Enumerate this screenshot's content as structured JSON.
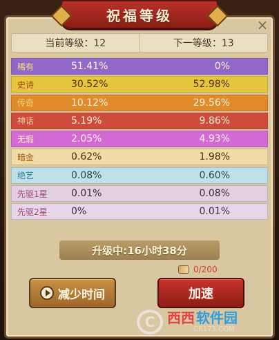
{
  "title": "祝福等级",
  "close_label": "×",
  "header": {
    "current": "当前等级：12",
    "next": "下一等级：13"
  },
  "rows": [
    {
      "name": "稀有",
      "current": "51.41%",
      "next": "0%"
    },
    {
      "name": "史诗",
      "current": "30.52%",
      "next": "52.98%"
    },
    {
      "name": "传奇",
      "current": "10.12%",
      "next": "29.56%"
    },
    {
      "name": "神话",
      "current": "5.19%",
      "next": "9.86%"
    },
    {
      "name": "无瑕",
      "current": "2.05%",
      "next": "4.93%"
    },
    {
      "name": "暗金",
      "current": "0.62%",
      "next": "1.98%"
    },
    {
      "name": "绝艺",
      "current": "0.08%",
      "next": "0.60%"
    },
    {
      "name": "先驱1星",
      "current": "0.01%",
      "next": "0.08%"
    },
    {
      "name": "先驱2星",
      "current": "0%",
      "next": "0.01%"
    }
  ],
  "upgrade_text": "升级中:16小时38分",
  "counter": "0/200",
  "buttons": {
    "reduce_time": "减少时间",
    "speed_up": "加速"
  },
  "watermark": {
    "logo": "C",
    "west": "西西",
    "soft": "软件园",
    "url": "CR173.COM"
  }
}
